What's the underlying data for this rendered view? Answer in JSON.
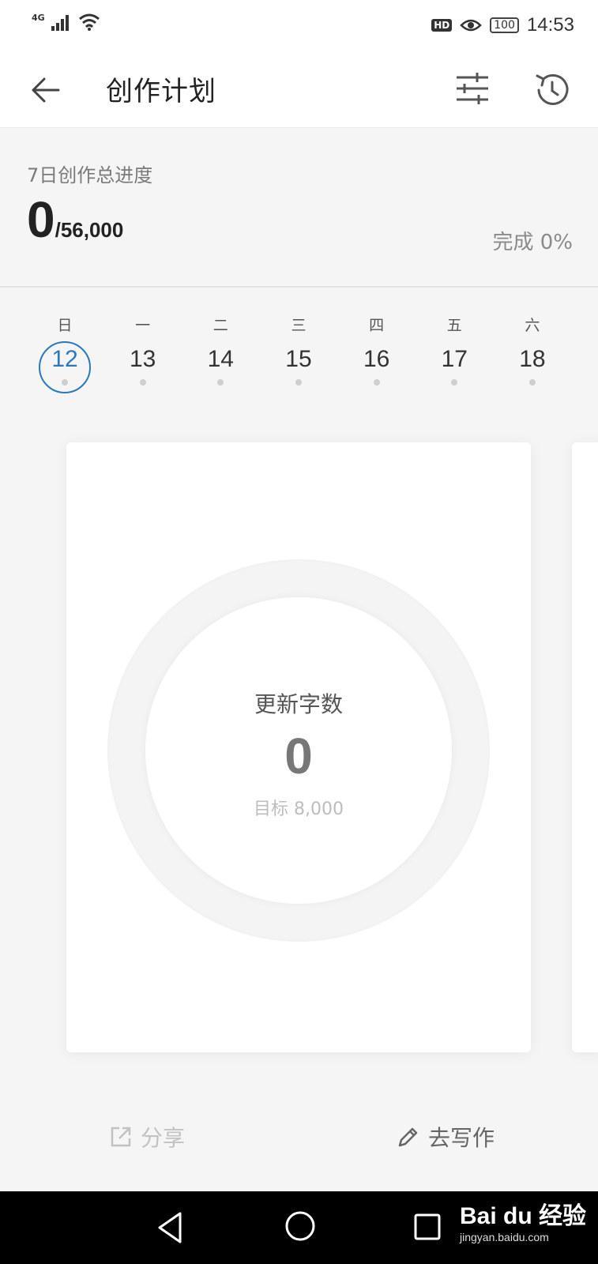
{
  "status_bar": {
    "network": "4G",
    "hd": "HD",
    "battery": "100",
    "time": "14:53"
  },
  "header": {
    "title": "创作计划",
    "back_icon": "arrow-left-icon",
    "filter_icon": "sliders-icon",
    "history_icon": "history-icon"
  },
  "progress": {
    "label": "7日创作总进度",
    "current": "0",
    "total": "/56,000",
    "completion": "完成 0%"
  },
  "week": [
    {
      "day": "日",
      "date": "12",
      "selected": true
    },
    {
      "day": "一",
      "date": "13",
      "selected": false
    },
    {
      "day": "二",
      "date": "14",
      "selected": false
    },
    {
      "day": "三",
      "date": "15",
      "selected": false
    },
    {
      "day": "四",
      "date": "16",
      "selected": false
    },
    {
      "day": "五",
      "date": "17",
      "selected": false
    },
    {
      "day": "六",
      "date": "18",
      "selected": false
    }
  ],
  "card": {
    "label": "更新字数",
    "value": "0",
    "target": "目标 8,000"
  },
  "actions": {
    "share_label": "分享",
    "write_label": "去写作"
  },
  "watermark": {
    "brand": "Bai du 经验",
    "url": "jingyan.baidu.com"
  },
  "colors": {
    "accent": "#2a78bd",
    "background": "#f5f5f5",
    "card": "#ffffff"
  }
}
